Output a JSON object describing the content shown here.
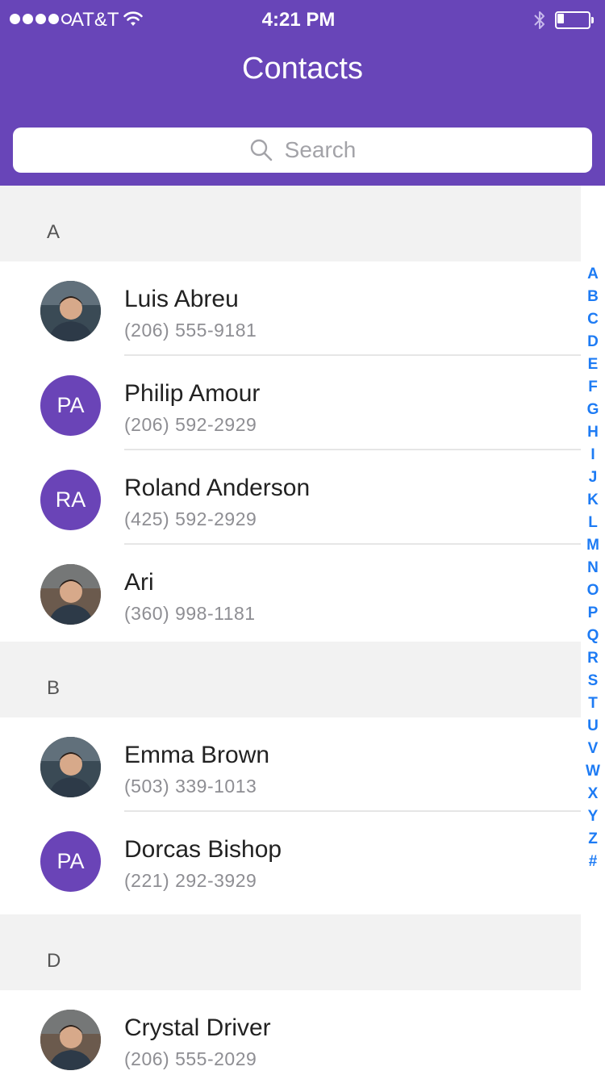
{
  "status_bar": {
    "carrier": "AT&T",
    "time": "4:21 PM",
    "signal_bars_filled": 4,
    "signal_bars_total": 5,
    "battery_level": 0.2
  },
  "header": {
    "title": "Contacts",
    "accent_color": "#6845b8"
  },
  "search": {
    "placeholder": "Search",
    "icon": "search-icon"
  },
  "sections": [
    {
      "letter": "A",
      "contacts": [
        {
          "name": "Luis Abreu",
          "phone": "(206) 555-9181",
          "avatar": "photo"
        },
        {
          "name": "Philip Amour",
          "phone": "(206) 592-2929",
          "avatar": "initials",
          "initials": "PA"
        },
        {
          "name": "Roland Anderson",
          "phone": "(425) 592-2929",
          "avatar": "initials",
          "initials": "RA"
        },
        {
          "name": "Ari",
          "phone": "(360) 998-1181",
          "avatar": "photo"
        }
      ]
    },
    {
      "letter": "B",
      "contacts": [
        {
          "name": "Emma Brown",
          "phone": "(503) 339-1013",
          "avatar": "photo"
        },
        {
          "name": "Dorcas Bishop",
          "phone": "(221) 292-3929",
          "avatar": "initials",
          "initials": "PA"
        }
      ]
    },
    {
      "letter": "D",
      "contacts": [
        {
          "name": "Crystal Driver",
          "phone": "(206) 555-2029",
          "avatar": "photo"
        }
      ]
    }
  ],
  "index_letters": [
    "A",
    "B",
    "C",
    "D",
    "E",
    "F",
    "G",
    "H",
    "I",
    "J",
    "K",
    "L",
    "M",
    "N",
    "O",
    "P",
    "Q",
    "R",
    "S",
    "T",
    "U",
    "V",
    "W",
    "X",
    "Y",
    "Z",
    "#"
  ],
  "index_color": "#1d7bf4"
}
